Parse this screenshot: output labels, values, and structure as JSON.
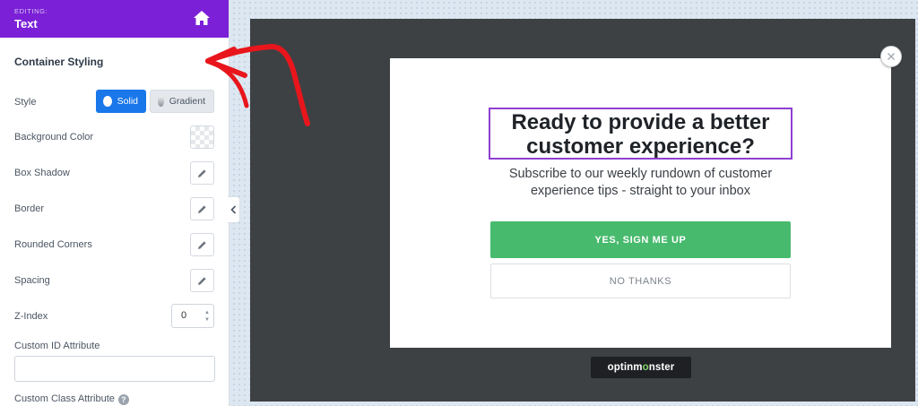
{
  "sidebar": {
    "header": {
      "editing_label": "EDITING:",
      "editing_value": "Text"
    },
    "section_title": "Container Styling",
    "style": {
      "label": "Style",
      "options": [
        "Solid",
        "Gradient"
      ],
      "selected": "Solid"
    },
    "background_color": {
      "label": "Background Color"
    },
    "box_shadow": {
      "label": "Box Shadow"
    },
    "border": {
      "label": "Border"
    },
    "rounded_corners": {
      "label": "Rounded Corners"
    },
    "spacing": {
      "label": "Spacing"
    },
    "z_index": {
      "label": "Z-Index",
      "value": "0"
    },
    "custom_id": {
      "label": "Custom ID Attribute",
      "value": ""
    },
    "custom_class": {
      "label": "Custom Class Attribute"
    }
  },
  "popup": {
    "headline": "Ready to provide a better customer experience?",
    "subtext": "Subscribe to our weekly rundown of customer experience tips - straight to your inbox",
    "cta_label": "YES, SIGN ME UP",
    "decline_label": "NO THANKS",
    "brand_prefix": "optinm",
    "brand_mid": "o",
    "brand_suffix": "nster"
  },
  "colors": {
    "header_purple": "#7b20d6",
    "accent_blue": "#1977ea",
    "cta_green": "#47ba6d",
    "selection_purple": "#8f3fd3",
    "canvas_dark": "#3e4144",
    "annotation_red": "#e8161c"
  },
  "icons": [
    "home-icon",
    "pencil-icon",
    "help-icon",
    "chevron-left-icon",
    "close-icon",
    "red-arrow-annotation"
  ]
}
